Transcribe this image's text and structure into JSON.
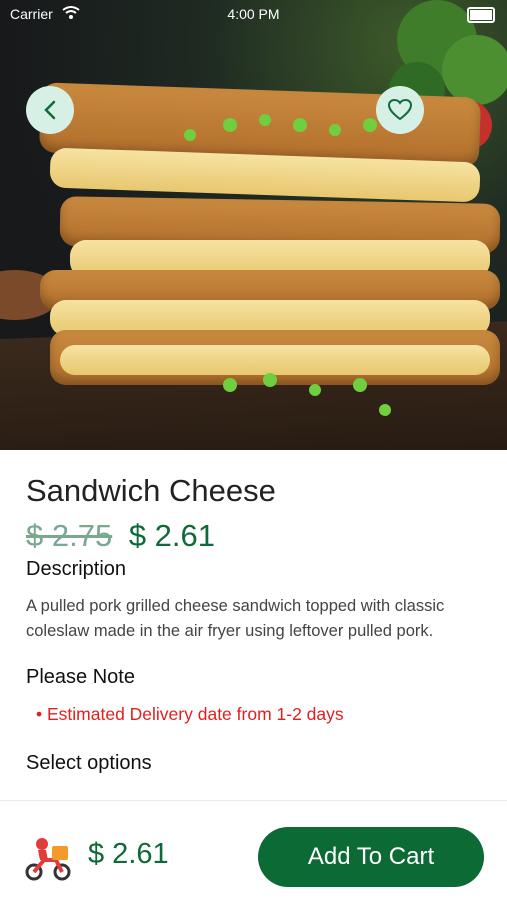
{
  "status_bar": {
    "carrier": "Carrier",
    "time": "4:00 PM"
  },
  "product": {
    "name": "Sandwich Cheese",
    "old_price": "$ 2.75",
    "new_price": "$ 2.61",
    "description_heading": "Description",
    "description": "A pulled pork grilled cheese sandwich topped with classic coleslaw made in the air fryer using leftover pulled pork.",
    "note_heading": "Please Note",
    "note_item": "• Estimated Delivery date from 1-2 days",
    "options_heading": "Select options"
  },
  "footer": {
    "total": "$ 2.61",
    "add_to_cart_label": "Add To Cart"
  },
  "icons": {
    "back": "chevron-left",
    "favorite": "heart",
    "delivery": "delivery-scooter",
    "wifi": "wifi",
    "battery": "battery"
  },
  "colors": {
    "brand_green": "#0c6a34",
    "accent_light": "#d7f0e5",
    "note_red": "#e02020"
  }
}
